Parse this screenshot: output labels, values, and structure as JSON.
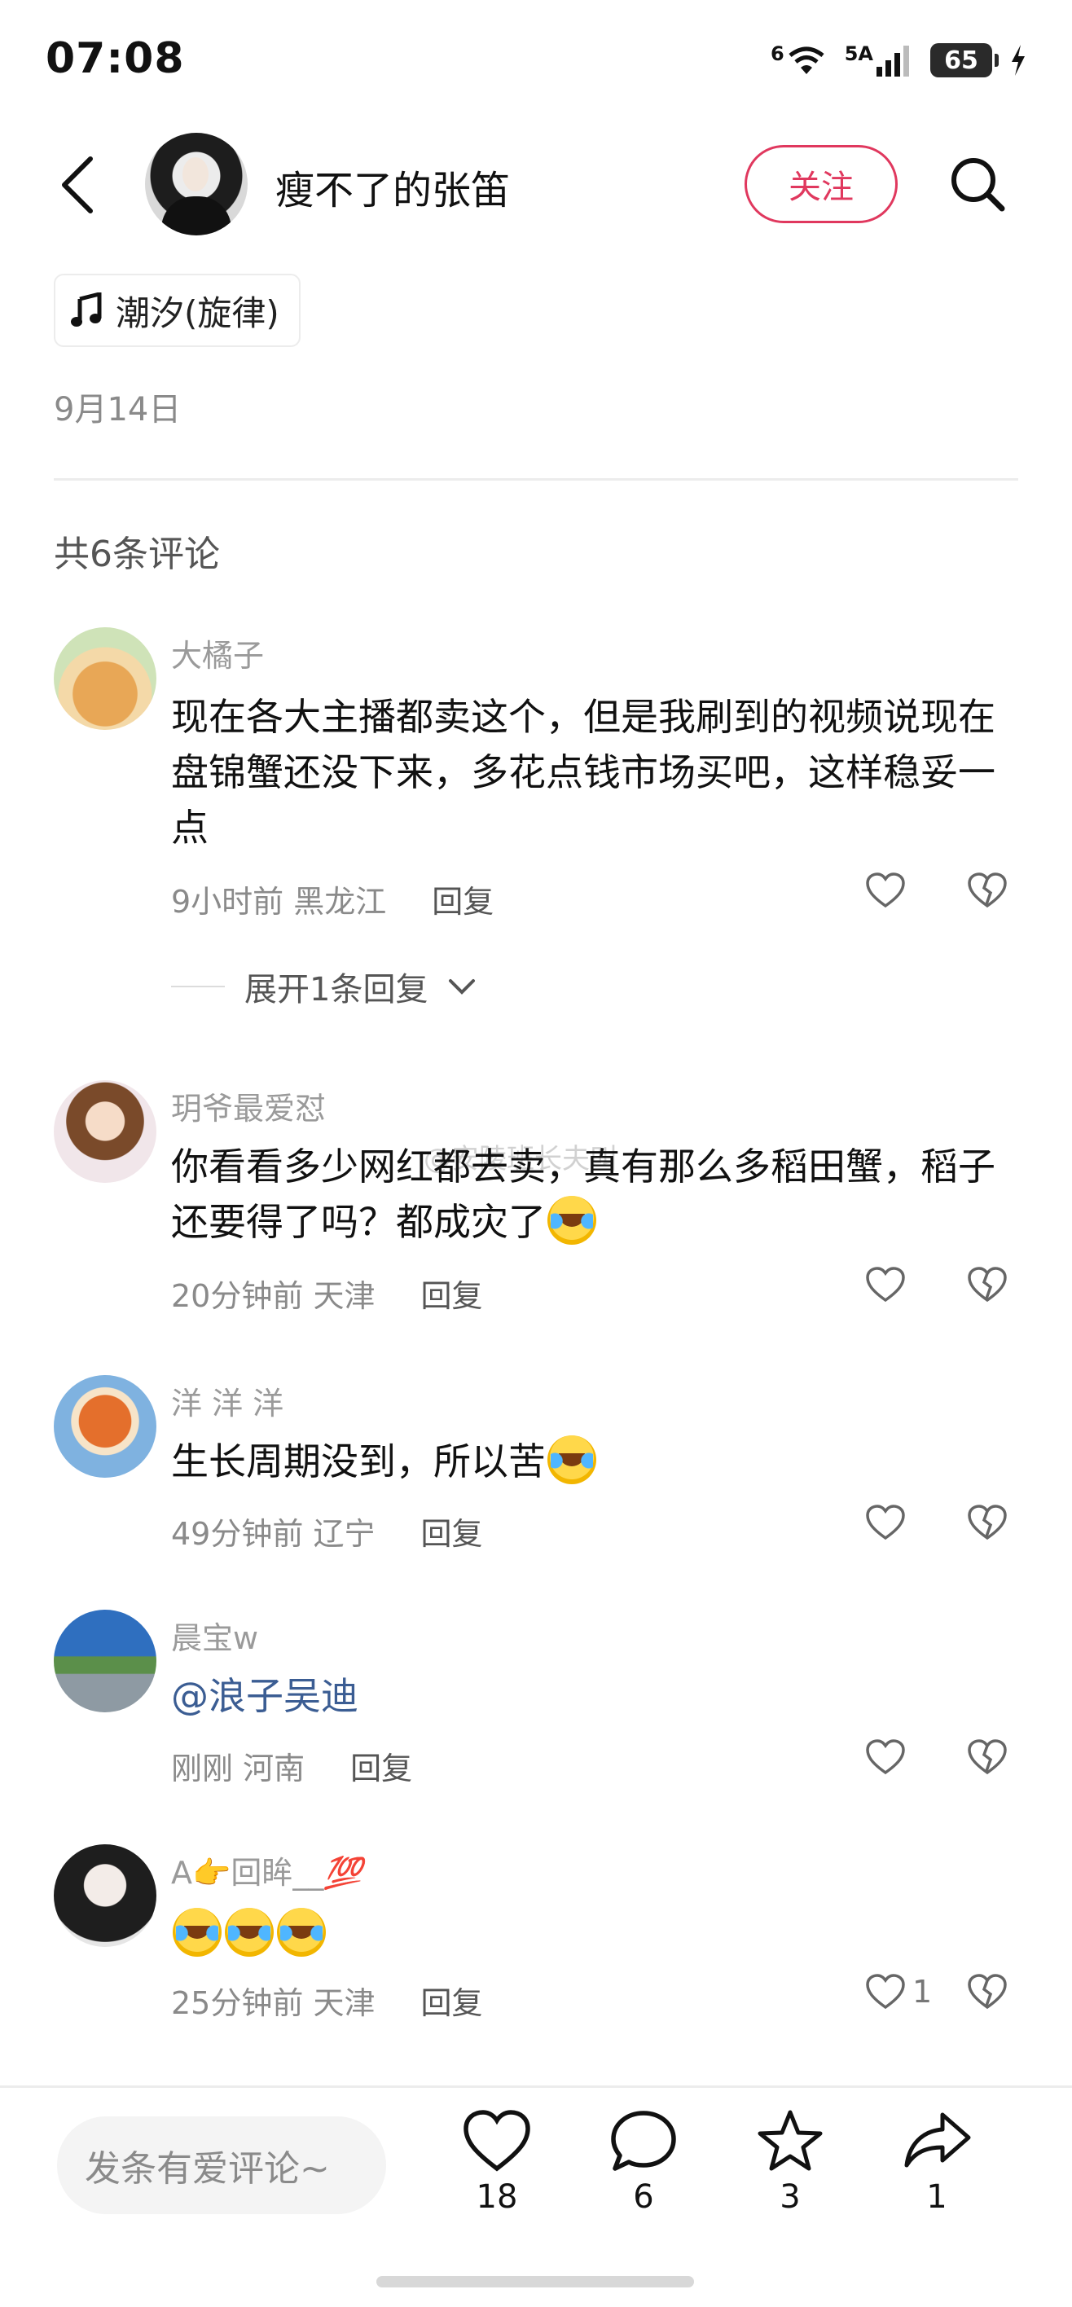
{
  "status_bar": {
    "time": "07:08",
    "wifi_label": "6",
    "signal_label": "5A",
    "battery": "65"
  },
  "header": {
    "author_name": "瘦不了的张笛",
    "follow_label": "关注"
  },
  "music": {
    "title": "潮汐(旋律)"
  },
  "post": {
    "date": "9月14日"
  },
  "comments_header": "共6条评论",
  "comments": [
    {
      "user": "大橘子",
      "text": "现在各大主播都卖这个，但是我刷到的视频说现在盘锦蟹还没下来，多花点钱市场买吧，这样稳妥一点",
      "time": "9小时前",
      "location": "黑龙江",
      "reply": "回复",
      "likes": ""
    },
    {
      "user": "玥爷最爱怼",
      "text": "你看看多少网红都去卖，真有那么多稻田蟹，稻子还要得了吗？都成灾了",
      "time": "20分钟前",
      "location": "天津",
      "reply": "回复",
      "likes": ""
    },
    {
      "user": "洋 洋 洋",
      "text": "生长周期没到，所以苦",
      "time": "49分钟前",
      "location": "辽宁",
      "reply": "回复",
      "likes": ""
    },
    {
      "user": "晨宝w",
      "text": "@浪子吴迪",
      "time": "刚刚",
      "location": "河南",
      "reply": "回复",
      "likes": ""
    },
    {
      "user_prefix": "A",
      "user_mid": "回眸__",
      "user_suffix": "💯",
      "text": "",
      "time": "25分钟前",
      "location": "天津",
      "reply": "回复",
      "likes": "1"
    }
  ],
  "expand_replies": "展开1条回复",
  "watermark": "@安陵班长夫叫",
  "bottom_bar": {
    "input_placeholder": "发条有爱评论~",
    "like_count": "18",
    "comment_count": "6",
    "favorite_count": "3",
    "share_count": "1"
  },
  "colors": {
    "accent": "#e0385e",
    "mention": "#3b5d93"
  }
}
